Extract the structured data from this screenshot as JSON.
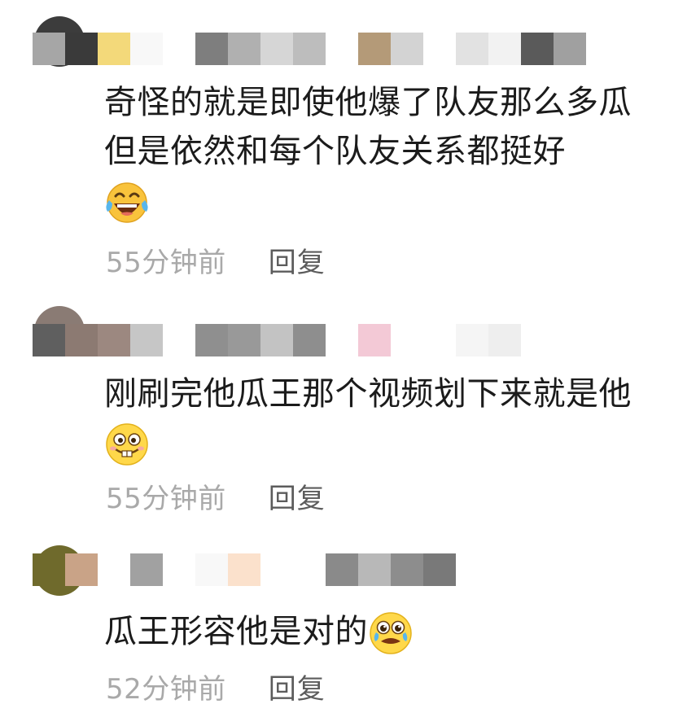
{
  "comments": [
    {
      "username_mosaic_colors": [
        "#a6a6a6",
        "#3a3a3a",
        "#f3d97a",
        "#f8f8f8",
        "#ffffff",
        "#7e7e7e",
        "#b0b0b0",
        "#d6d6d6",
        "#bdbdbd",
        "#ffffff",
        "#b49a78",
        "#d3d3d3",
        "#ffffff",
        "#e2e2e2",
        "#f2f2f2",
        "#5a5a5a",
        "#a0a0a0"
      ],
      "text": "奇怪的就是即使他爆了队友那么多瓜但是依然和每个队友关系都挺好",
      "emoji": "laughing-with-tears-emoji",
      "timestamp": "55分钟前",
      "reply_label": "回复"
    },
    {
      "username_mosaic_colors": [
        "#5f5f5f",
        "#8c7a72",
        "#9c8880",
        "#c6c6c6",
        "#ffffff",
        "#8f8f8f",
        "#999999",
        "#c3c3c3",
        "#8e8e8e",
        "#ffffff",
        "#f3c9d6",
        "#ffffff",
        "#ffffff",
        "#f5f5f5",
        "#eeeeee"
      ],
      "text": "刚刷完他瓜王那个视频划下来就是他",
      "emoji": "bucktooth-grin-emoji",
      "timestamp": "55分钟前",
      "reply_label": "回复"
    },
    {
      "username_mosaic_colors": [
        "#6f6a2c",
        "#c9a387",
        "#ffffff",
        "#a1a1a1",
        "#ffffff",
        "#f8f8f8",
        "#fbe1cc",
        "#ffffff",
        "#ffffff",
        "#8a8a8a",
        "#b8b8b8",
        "#8d8d8d",
        "#797979"
      ],
      "text": "瓜王形容他是对的",
      "emoji": "teary-eyed-emoji",
      "timestamp": "52分钟前",
      "reply_label": "回复"
    }
  ]
}
